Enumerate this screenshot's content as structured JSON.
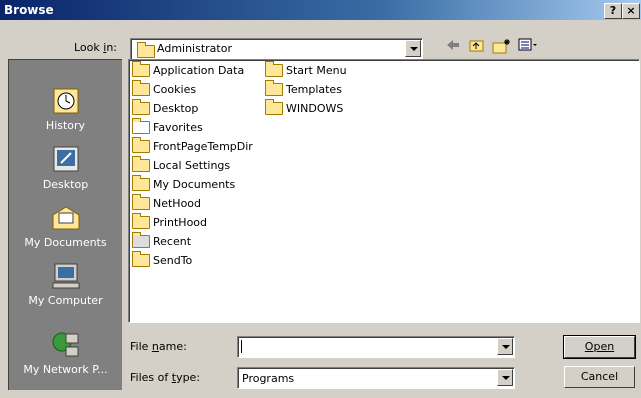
{
  "window": {
    "title": "Browse",
    "help_label": "?",
    "close_label": "×"
  },
  "lookin": {
    "label": "Look in:",
    "value": "Administrator"
  },
  "toolbar": {
    "back_icon": "back-arrow-icon",
    "up_icon": "up-folder-icon",
    "new_folder_icon": "new-folder-icon",
    "views_icon": "views-menu-icon"
  },
  "places": [
    {
      "label": "History",
      "icon": "history-icon"
    },
    {
      "label": "Desktop",
      "icon": "desktop-icon"
    },
    {
      "label": "My Documents",
      "icon": "my-documents-icon"
    },
    {
      "label": "My Computer",
      "icon": "my-computer-icon"
    },
    {
      "label": "My Network P...",
      "icon": "my-network-places-icon"
    }
  ],
  "files": [
    {
      "name": "Application Data",
      "icon": "folder-icon"
    },
    {
      "name": "Cookies",
      "icon": "folder-icon"
    },
    {
      "name": "Desktop",
      "icon": "folder-icon"
    },
    {
      "name": "Favorites",
      "icon": "favorites-folder-icon"
    },
    {
      "name": "FrontPageTempDir",
      "icon": "folder-icon"
    },
    {
      "name": "Local Settings",
      "icon": "folder-icon"
    },
    {
      "name": "My Documents",
      "icon": "folder-icon"
    },
    {
      "name": "NetHood",
      "icon": "folder-icon"
    },
    {
      "name": "PrintHood",
      "icon": "folder-icon"
    },
    {
      "name": "Recent",
      "icon": "recent-folder-icon"
    },
    {
      "name": "SendTo",
      "icon": "folder-icon"
    },
    {
      "name": "Start Menu",
      "icon": "folder-icon"
    },
    {
      "name": "Templates",
      "icon": "folder-icon"
    },
    {
      "name": "WINDOWS",
      "icon": "folder-icon"
    }
  ],
  "filename": {
    "label": "File name:",
    "value": ""
  },
  "filetype": {
    "label": "Files of type:",
    "value": "Programs"
  },
  "buttons": {
    "open": "Open",
    "cancel": "Cancel"
  }
}
